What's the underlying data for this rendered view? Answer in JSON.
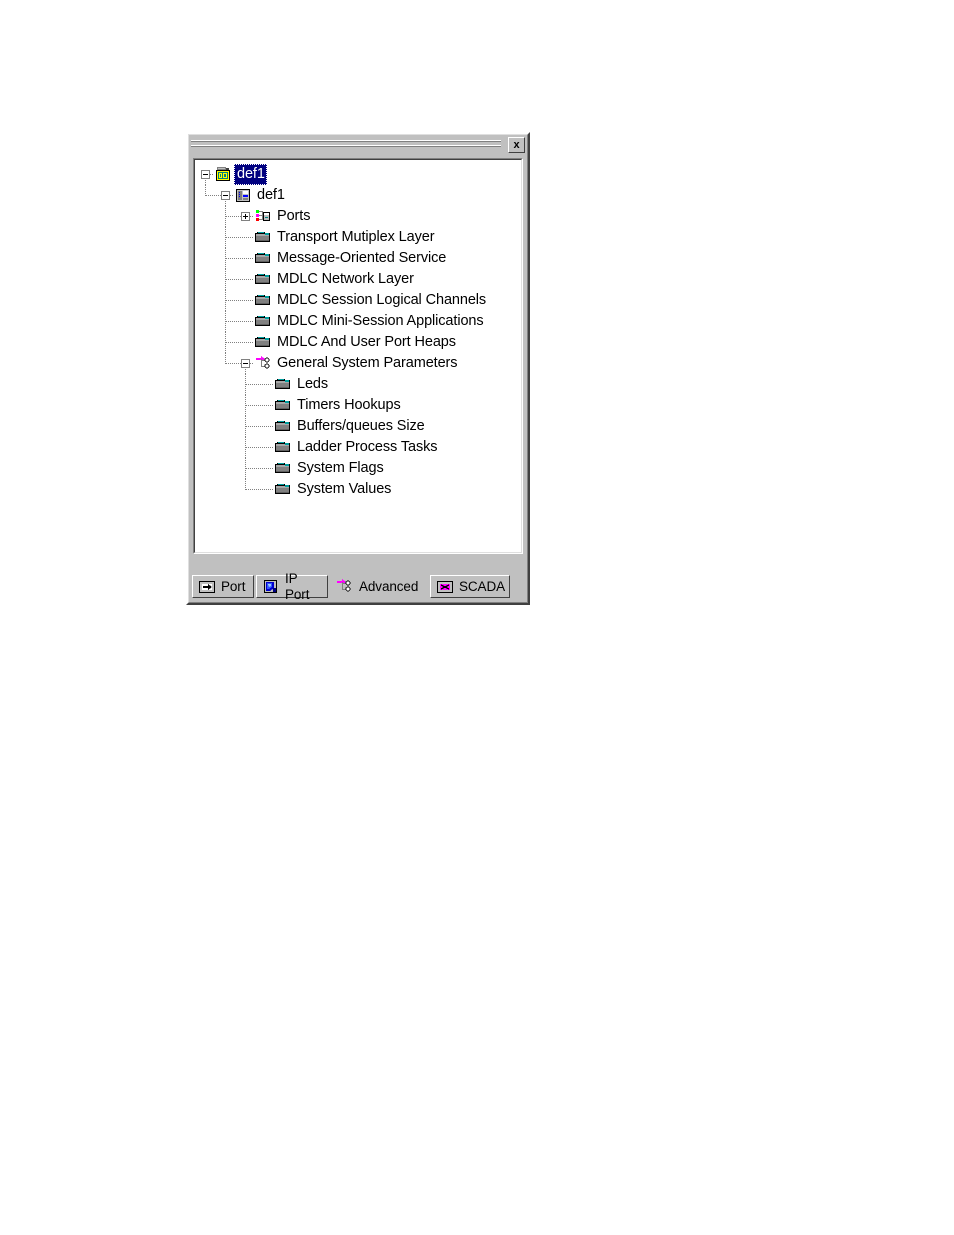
{
  "window": {
    "close_label": "×",
    "close_glyph": "x"
  },
  "tree": {
    "nodes": [
      {
        "label": "def1",
        "level": 0,
        "icon": "project-camera-icon",
        "expander": "minus",
        "selected": true
      },
      {
        "label": "def1",
        "level": 1,
        "icon": "rtu-unit-icon",
        "expander": "minus",
        "selected": false
      },
      {
        "label": "Ports",
        "level": 2,
        "icon": "ports-network-icon",
        "expander": "plus",
        "selected": false
      },
      {
        "label": "Transport Mutiplex Layer",
        "level": 2,
        "icon": "folder-icon",
        "expander": "none",
        "selected": false
      },
      {
        "label": "Message-Oriented Service",
        "level": 2,
        "icon": "folder-icon",
        "expander": "none",
        "selected": false
      },
      {
        "label": "MDLC Network Layer",
        "level": 2,
        "icon": "folder-icon",
        "expander": "none",
        "selected": false
      },
      {
        "label": "MDLC Session Logical Channels",
        "level": 2,
        "icon": "folder-icon",
        "expander": "none",
        "selected": false
      },
      {
        "label": "MDLC Mini-Session Applications",
        "level": 2,
        "icon": "folder-icon",
        "expander": "none",
        "selected": false
      },
      {
        "label": "MDLC And User Port Heaps",
        "level": 2,
        "icon": "folder-icon",
        "expander": "none",
        "selected": false
      },
      {
        "label": "General System Parameters",
        "level": 2,
        "icon": "advanced-branch-icon",
        "expander": "minus",
        "selected": false
      },
      {
        "label": "Leds",
        "level": 3,
        "icon": "folder-icon",
        "expander": "none",
        "selected": false
      },
      {
        "label": "Timers Hookups",
        "level": 3,
        "icon": "folder-icon",
        "expander": "none",
        "selected": false
      },
      {
        "label": "Buffers/queues Size",
        "level": 3,
        "icon": "folder-icon",
        "expander": "none",
        "selected": false
      },
      {
        "label": "Ladder Process Tasks",
        "level": 3,
        "icon": "folder-icon",
        "expander": "none",
        "selected": false
      },
      {
        "label": "System Flags",
        "level": 3,
        "icon": "folder-icon",
        "expander": "none",
        "selected": false
      },
      {
        "label": "System Values",
        "level": 3,
        "icon": "folder-icon",
        "expander": "none",
        "selected": false
      }
    ]
  },
  "tabs": [
    {
      "label": "Port",
      "icon": "port-icon",
      "active": false
    },
    {
      "label": "IP Port",
      "icon": "ip-port-icon",
      "active": false
    },
    {
      "label": "Advanced",
      "icon": "advanced-icon",
      "active": true
    },
    {
      "label": "SCADA",
      "icon": "scada-icon",
      "active": false
    }
  ],
  "colors": {
    "face": "#c0c0c0",
    "selection": "#000080",
    "selection_text": "#ffffff",
    "tree_background": "#ffffff",
    "text": "#000000",
    "line": "#808080"
  }
}
